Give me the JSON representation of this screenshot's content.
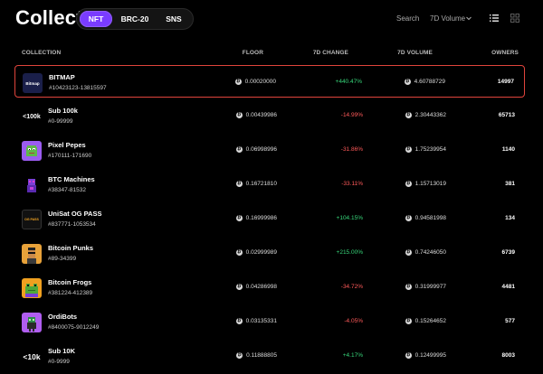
{
  "header": {
    "title": "Collect",
    "tabs": [
      {
        "label": "NFT",
        "active": true
      },
      {
        "label": "BRC-20",
        "active": false
      },
      {
        "label": "SNS",
        "active": false
      }
    ],
    "search_label": "Search",
    "sort_label": "7D Volume",
    "accent": "#7a3cff"
  },
  "table": {
    "columns": [
      "COLLECTION",
      "FLOOR",
      "7D CHANGE",
      "7D VOLUME",
      "OWNERS"
    ],
    "btc_symbol": "₿",
    "rows": [
      {
        "name": "BITMAP",
        "range": "#10423123-13815597",
        "floor": "0.00020000",
        "change": "+440.47%",
        "volume": "4.60788729",
        "owners": "14997",
        "thumb_text": "Bitmap"
      },
      {
        "name": "Sub 100k",
        "range": "#0-99999",
        "floor": "0.00439986",
        "change": "-14.99%",
        "volume": "2.30443362",
        "owners": "65713",
        "thumb_text": "<100k"
      },
      {
        "name": "Pixel Pepes",
        "range": "#170111-171690",
        "floor": "0.06998996",
        "change": "-31.86%",
        "volume": "1.75239954",
        "owners": "1140",
        "thumb_text": ""
      },
      {
        "name": "BTC Machines",
        "range": "#38347-81532",
        "floor": "0.16721810",
        "change": "-33.11%",
        "volume": "1.15713019",
        "owners": "381",
        "thumb_text": ""
      },
      {
        "name": "UniSat OG PASS",
        "range": "#837771-1053534",
        "floor": "0.16999986",
        "change": "+104.15%",
        "volume": "0.94581998",
        "owners": "134",
        "thumb_text": "OG PASS"
      },
      {
        "name": "Bitcoin Punks",
        "range": "#89-34399",
        "floor": "0.02999989",
        "change": "+215.00%",
        "volume": "0.74246050",
        "owners": "6739",
        "thumb_text": ""
      },
      {
        "name": "Bitcoin Frogs",
        "range": "#381224-412389",
        "floor": "0.04286998",
        "change": "-34.72%",
        "volume": "0.31999977",
        "owners": "4481",
        "thumb_text": ""
      },
      {
        "name": "OrdiBots",
        "range": "#8400075-9012249",
        "floor": "0.03135331",
        "change": "-4.05%",
        "volume": "0.15264652",
        "owners": "577",
        "thumb_text": ""
      },
      {
        "name": "Sub 10K",
        "range": "#0-9999",
        "floor": "0.11888805",
        "change": "+4.17%",
        "volume": "0.12499995",
        "owners": "8003",
        "thumb_text": "<10k"
      }
    ]
  }
}
